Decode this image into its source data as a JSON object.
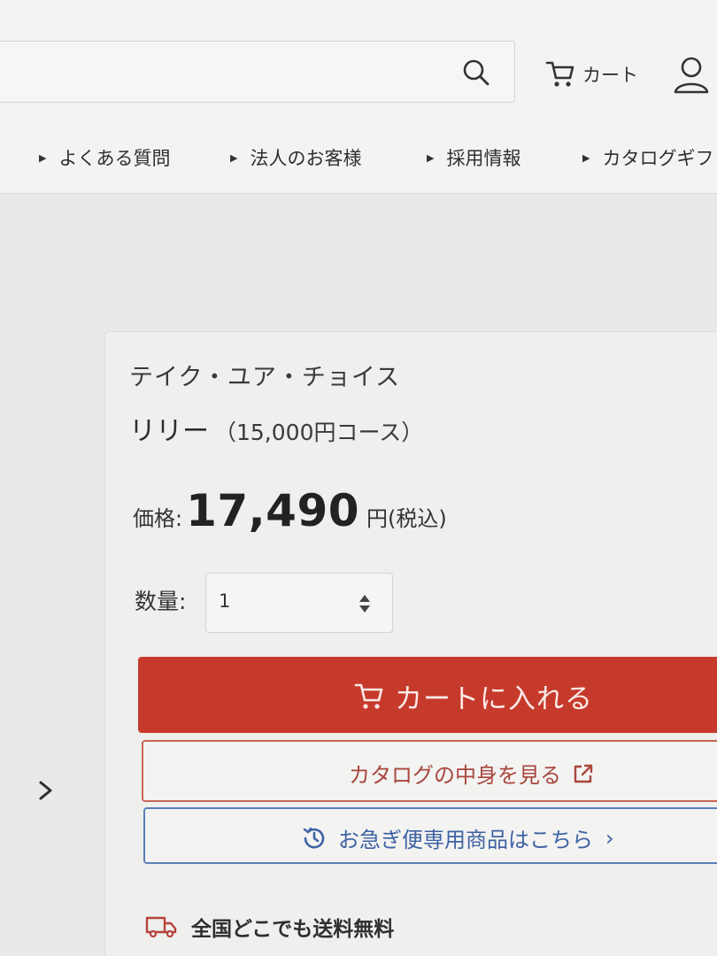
{
  "header": {
    "cart_label": "カート",
    "nav": [
      {
        "label": "よくある質問"
      },
      {
        "label": "法人のお客様"
      },
      {
        "label": "採用情報"
      },
      {
        "label": "カタログギフ"
      }
    ]
  },
  "product": {
    "brand": "テイク・ユア・チョイス",
    "name": "リリー",
    "course": "（15,000円コース）",
    "price_label": "価格:",
    "price": "17,490",
    "price_unit": "円",
    "price_tax": "(税込)",
    "quantity_label": "数量:",
    "quantity_value": "1"
  },
  "actions": {
    "add_to_cart": "カートに入れる",
    "view_catalog": "カタログの中身を見る",
    "express": "お急ぎ便専用商品はこちら",
    "shipping": "全国どこでも送料無料"
  },
  "colors": {
    "cart_button": "#c63a2c",
    "catalog_border": "#c96556",
    "express_border": "#5a7fb8"
  },
  "icons": {
    "search": "search-icon",
    "cart": "cart-icon",
    "account": "user-icon",
    "external": "external-link-icon",
    "clock": "clock-icon",
    "truck": "truck-icon"
  }
}
